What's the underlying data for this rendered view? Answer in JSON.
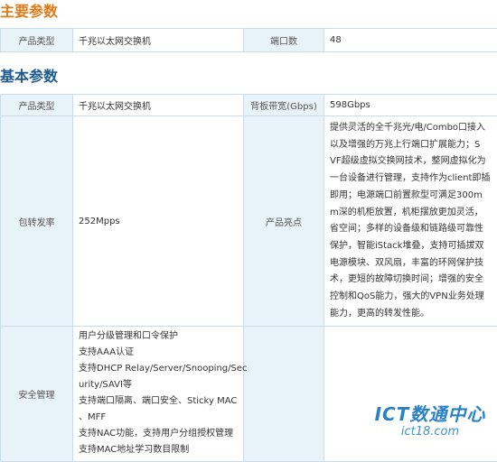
{
  "sections": {
    "main_title": "主要参数",
    "basic_title": "基本参数"
  },
  "main_params": {
    "type_label": "产品类型",
    "type_value": "千兆以太网交换机",
    "ports_label": "端口数",
    "ports_value": "48"
  },
  "basic_params": {
    "type_label": "产品类型",
    "type_value": "千兆以太网交换机",
    "bandwidth_label": "背板带宽(Gbps)",
    "bandwidth_value": "598Gbps",
    "forwarding_label": "包转发率",
    "forwarding_value": "252Mpps",
    "highlights_label": "产品亮点",
    "highlights_lines": [
      "提供灵活的全千兆光/电/Combo口接入",
      "以及增强的万兆上行端口扩展能力；S",
      "VF超级虚拟交换网技术，整网虚拟化为",
      "一台设备进行管理，支持作为client即插",
      "即用；电源端口前置款型可满足300m",
      "m深的机柜放置，机柜摆放更加灵活，",
      "省空间；多样的设备级和链路级可靠性",
      "保护，智能iStack堆叠，支持可插拔双",
      "电源模块、双风扇，丰富的环网保护技",
      "术，更短的故障切换时间；增强的安全",
      "控制和QoS能力，强大的VPN业务处理",
      "能力，更高的转发性能。"
    ],
    "security_label": "安全管理",
    "security_lines": [
      "用户分级管理和口令保护",
      "支持AAA认证",
      "支持DHCP Relay/Server/Snooping/Sec",
      "urity/SAVI等",
      "支持端口隔离、端口安全、Sticky MAC",
      "、MFF",
      "支持NAC功能，支持用户分组授权管理",
      "支持MAC地址学习数目限制"
    ]
  },
  "watermark": {
    "main": "ICT数通中心",
    "sub": "ict18.com"
  }
}
